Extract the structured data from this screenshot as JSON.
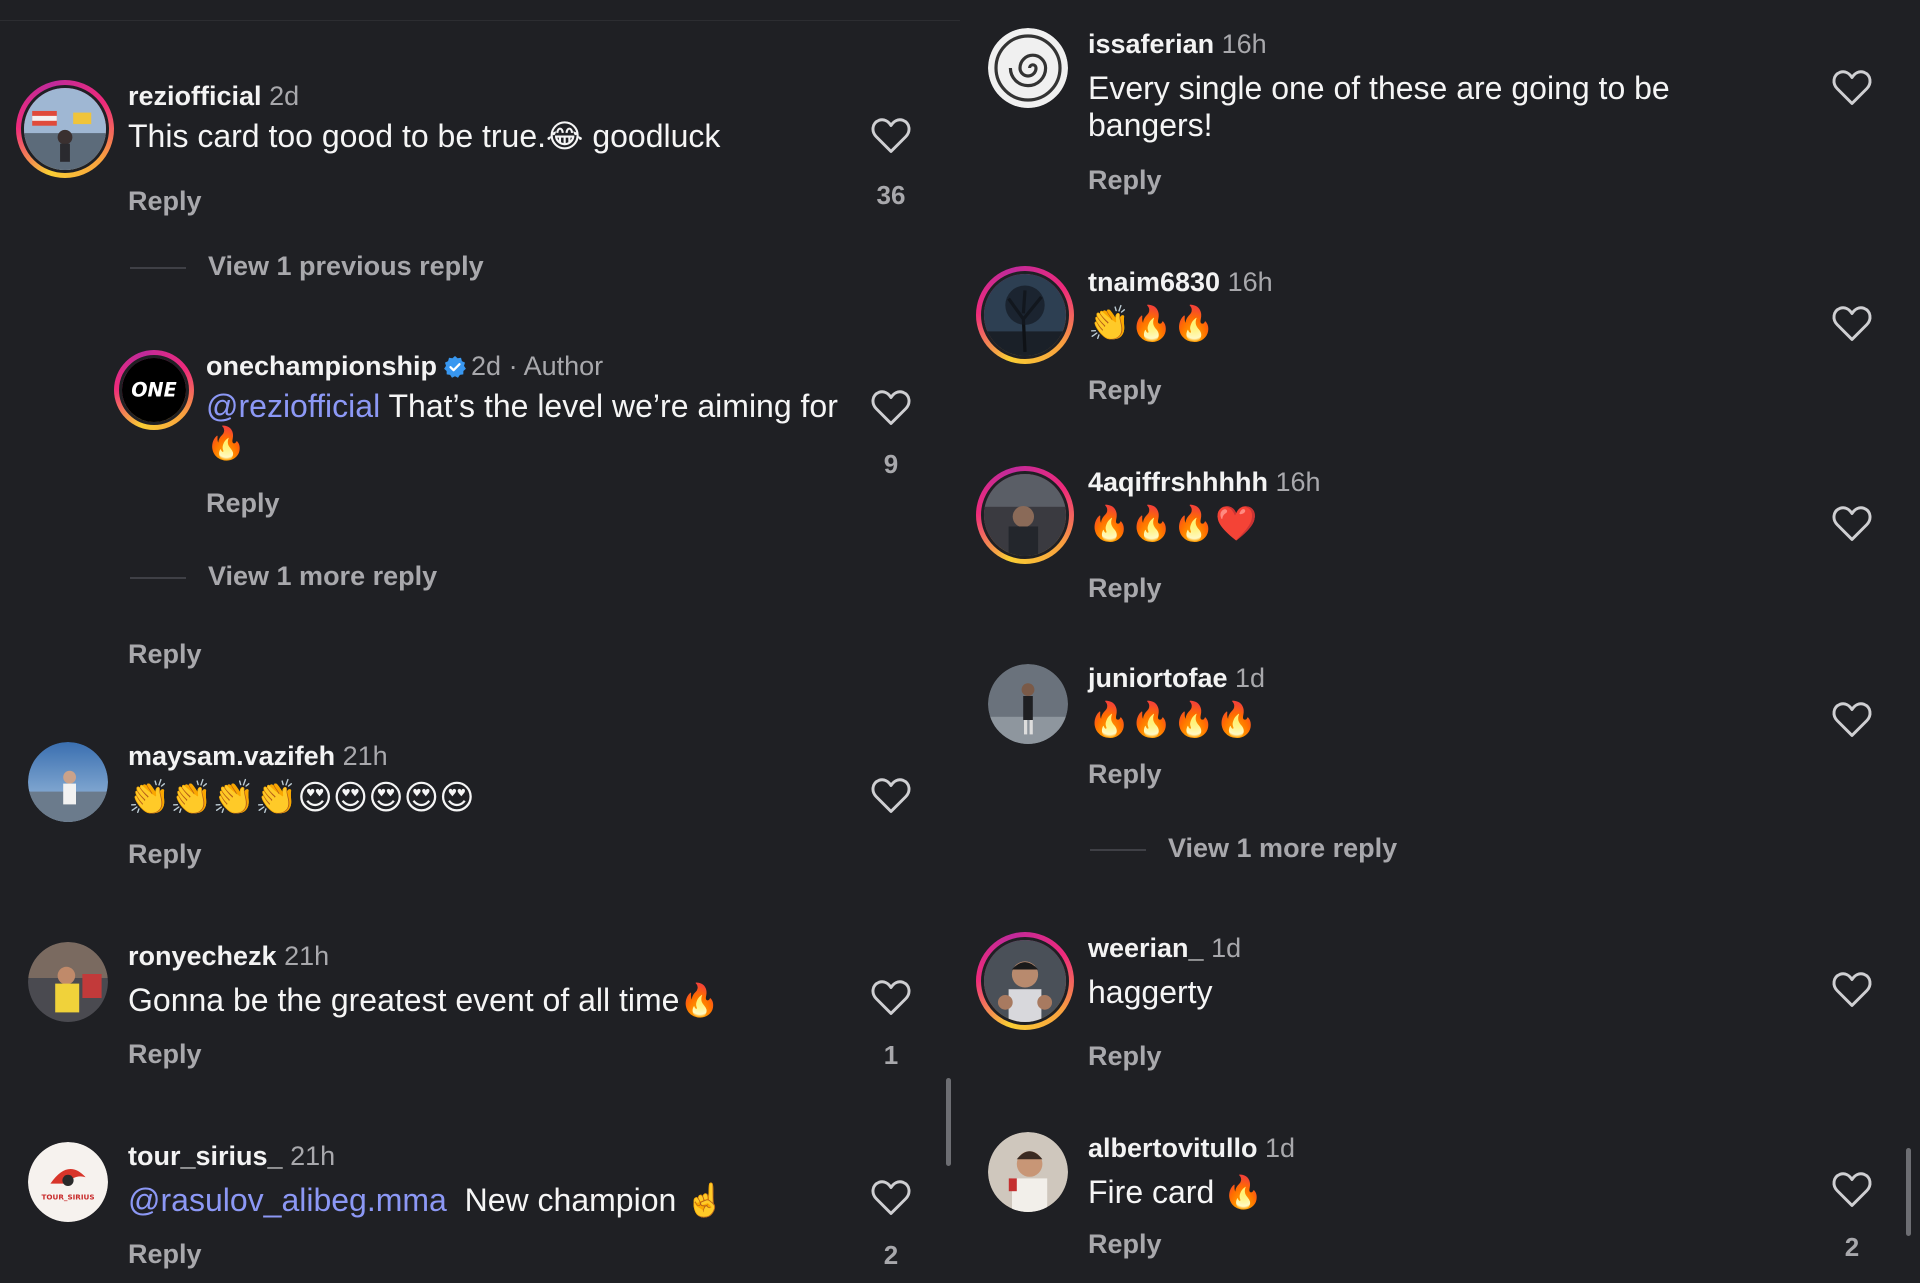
{
  "left": {
    "comments": [
      {
        "username": "reziofficial",
        "time": "2d",
        "text": "This card too good to be true.😂 goodluck",
        "reply": "Reply",
        "likes": "36",
        "view_replies": "View 1 previous reply"
      },
      {
        "username": "onechampionship",
        "time": "2d",
        "author": "· Author",
        "avatar_text": "ONE",
        "mention": "@reziofficial",
        "text": " That’s the level we’re aiming for🔥",
        "reply": "Reply",
        "likes": "9",
        "view_replies": "View 1 more reply",
        "parent_reply": "Reply"
      },
      {
        "username": "maysam.vazifeh",
        "time": "21h",
        "text": "👏👏👏👏😍😍😍😍😍",
        "reply": "Reply"
      },
      {
        "username": "ronyechezk",
        "time": "21h",
        "text": "Gonna be the greatest event of all time🔥",
        "reply": "Reply",
        "likes": "1"
      },
      {
        "username": "tour_sirius_",
        "time": "21h",
        "avatar_text": "TOUR_SIRIUS",
        "mention": "@rasulov_alibeg.mma",
        "text": "  New champion ☝️",
        "reply": "Reply",
        "likes": "2"
      }
    ]
  },
  "right": {
    "comments": [
      {
        "username": "issaferian",
        "time": "16h",
        "text": "Every single one of these are going to be bangers!",
        "reply": "Reply"
      },
      {
        "username": "tnaim6830",
        "time": "16h",
        "text": "👏🔥🔥",
        "reply": "Reply"
      },
      {
        "username": "4aqiffrshhhhh",
        "time": "16h",
        "text": "🔥🔥🔥❤️",
        "reply": "Reply"
      },
      {
        "username": "juniortofae",
        "time": "1d",
        "text": "🔥🔥🔥🔥",
        "reply": "Reply",
        "view_replies": "View 1 more reply"
      },
      {
        "username": "weerian_",
        "time": "1d",
        "text": "haggerty",
        "reply": "Reply"
      },
      {
        "username": "albertovitullo",
        "time": "1d",
        "text": "Fire card 🔥",
        "reply": "Reply",
        "likes": "2"
      }
    ]
  },
  "colors": {
    "background": "#1f2024",
    "mention": "#8c98f5",
    "secondary": "#a8a8ac",
    "verified": "#3897f0"
  },
  "icons": [
    "heart-outline-icon",
    "verified-badge-icon"
  ]
}
